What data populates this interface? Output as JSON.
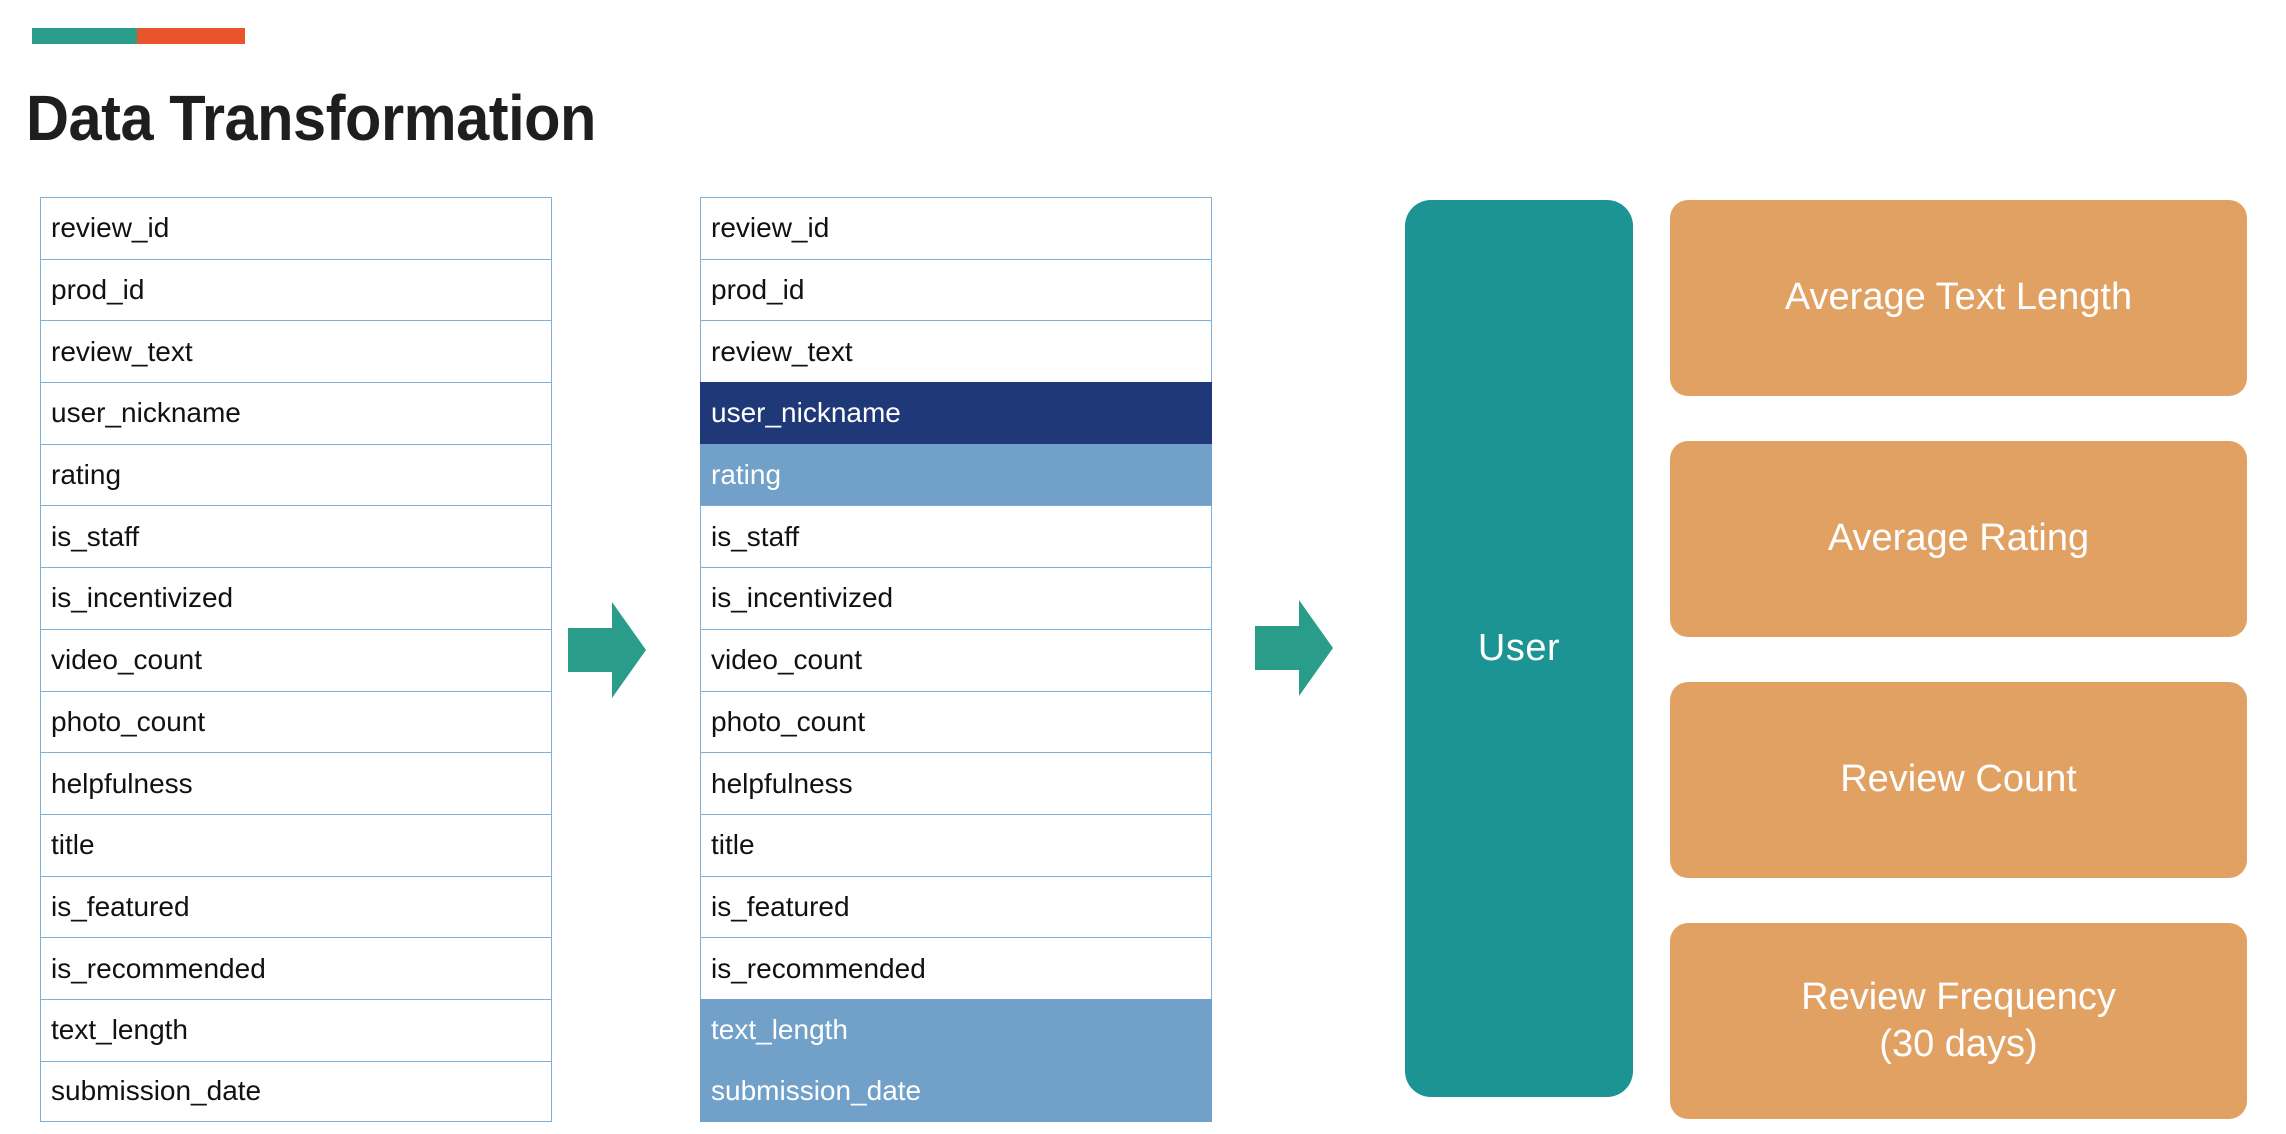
{
  "accent_bar": {
    "teal_color": "#2A9D8A",
    "orange_color": "#E8552A"
  },
  "page_title": "Data Transformation",
  "colors": {
    "table_border": "#7FAFD4",
    "highlight_navy": "#1F3878",
    "highlight_steel": "#71A0C8",
    "entity_teal": "#1B9493",
    "metric_orange": "#E0A163",
    "arrow_teal": "#2A9D8A",
    "title_text": "#1E1E1E"
  },
  "source_table": {
    "name": "source-fields",
    "fields": [
      "review_id",
      "prod_id",
      "review_text",
      "user_nickname",
      "rating",
      "is_staff",
      "is_incentivized",
      "video_count",
      "photo_count",
      "helpfulness",
      "title",
      "is_featured",
      "is_recommended",
      "text_length",
      "submission_date"
    ]
  },
  "selected_table": {
    "name": "selected-fields",
    "fields": [
      {
        "label": "review_id",
        "highlight": "none"
      },
      {
        "label": "prod_id",
        "highlight": "none"
      },
      {
        "label": "review_text",
        "highlight": "none"
      },
      {
        "label": "user_nickname",
        "highlight": "navy"
      },
      {
        "label": "rating",
        "highlight": "steel"
      },
      {
        "label": "is_staff",
        "highlight": "none"
      },
      {
        "label": "is_incentivized",
        "highlight": "none"
      },
      {
        "label": "video_count",
        "highlight": "none"
      },
      {
        "label": "photo_count",
        "highlight": "none"
      },
      {
        "label": "helpfulness",
        "highlight": "none"
      },
      {
        "label": "title",
        "highlight": "none"
      },
      {
        "label": "is_featured",
        "highlight": "none"
      },
      {
        "label": "is_recommended",
        "highlight": "none"
      },
      {
        "label": "text_length",
        "highlight": "steel-merge-top"
      },
      {
        "label": "submission_date",
        "highlight": "steel-merge-bottom"
      }
    ]
  },
  "entity": {
    "label": "User"
  },
  "metrics": [
    {
      "label": "Average Text Length"
    },
    {
      "label": "Average Rating"
    },
    {
      "label": "Review Count"
    },
    {
      "label": "Review Frequency\n(30 days)",
      "line1": "Review Frequency",
      "line2": "(30 days)"
    }
  ],
  "arrows": {
    "arrow_1_name": "transform-arrow-1",
    "arrow_2_name": "transform-arrow-2"
  }
}
